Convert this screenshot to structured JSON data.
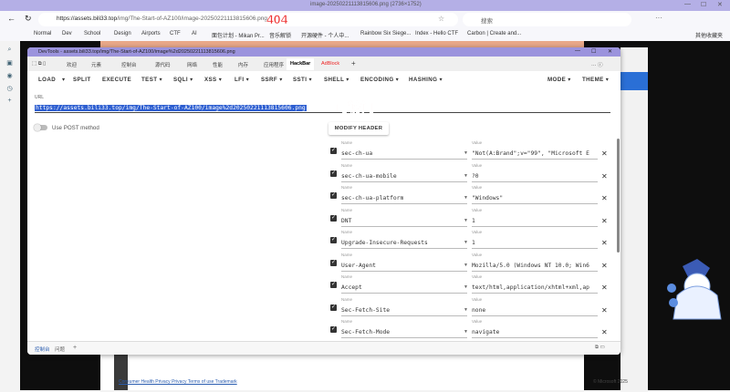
{
  "browser": {
    "tab_title": "image-20250221113815606.png (2736×1752)",
    "url_domain": "https://assets.bili33.top",
    "url_path": "/img/The-Start-of-AZ100/image-20250221113815606.png",
    "search_placeholder": "搜索",
    "annotation_404": "404",
    "bookmarks": [
      "Normal",
      "Dev",
      "School",
      "Design",
      "Airports",
      "CTF",
      "AI",
      "面包计划 - Mikan Pr...",
      "音乐解锁",
      "开源硬件 - 个人中...",
      "Rainbow Six Siege...",
      "Index - Hello CTF",
      "Carbon | Create and..."
    ],
    "other_bookmarks": "其他收藏夹"
  },
  "page": {
    "footer_links": "Consumer Health Privacy  Privacy  Terms of use  Trademark",
    "copyright": "© Microsoft 2025"
  },
  "devtools": {
    "title": "DevTools - assets.bili33.top/img/The-Start-of-AZ100/image%2d20250221113815606.png",
    "tabs": [
      "欢迎",
      "元素",
      "控制台",
      "源代码",
      "网络",
      "性能",
      "内存",
      "应用程序",
      "HackBar",
      "AdBlock",
      "+"
    ],
    "drawer_tabs": [
      "控制台",
      "问题",
      "+"
    ]
  },
  "hackbar": {
    "menu": [
      "LOAD",
      "SPLIT",
      "EXECUTE",
      "TEST ▾",
      "SQLI ▾",
      "XSS ▾",
      "LFI ▾",
      "SSRF ▾",
      "SSTI ▾",
      "SHELL ▾",
      "ENCODING ▾",
      "HASHING ▾",
      "MODE ▾",
      "THEME ▾"
    ],
    "url_label": "URL",
    "url_value": "https://assets.bili33.top/img/The-Start-of-AZ100/image%2d20250221113815606.png",
    "annotation": "可访问",
    "post_label": "Use POST method",
    "post_enabled": false,
    "modify_header": "MODIFY HEADER",
    "name_label": "Name",
    "value_label": "Value",
    "headers": [
      {
        "name": "sec-ch-ua",
        "value": "\"Not(A:Brand\";v=\"99\", \"Microsoft E",
        "checked": true
      },
      {
        "name": "sec-ch-ua-mobile",
        "value": "?0",
        "checked": true
      },
      {
        "name": "sec-ch-ua-platform",
        "value": "\"Windows\"",
        "checked": true
      },
      {
        "name": "DNT",
        "value": "1",
        "checked": true
      },
      {
        "name": "Upgrade-Insecure-Requests",
        "value": "1",
        "checked": true
      },
      {
        "name": "User-Agent",
        "value": "Mozilla/5.0 (Windows NT 10.0; Win6",
        "checked": true
      },
      {
        "name": "Accept",
        "value": "text/html,application/xhtml+xml,ap",
        "checked": true
      },
      {
        "name": "Sec-Fetch-Site",
        "value": "none",
        "checked": true
      },
      {
        "name": "Sec-Fetch-Mode",
        "value": "navigate",
        "checked": true
      }
    ]
  }
}
